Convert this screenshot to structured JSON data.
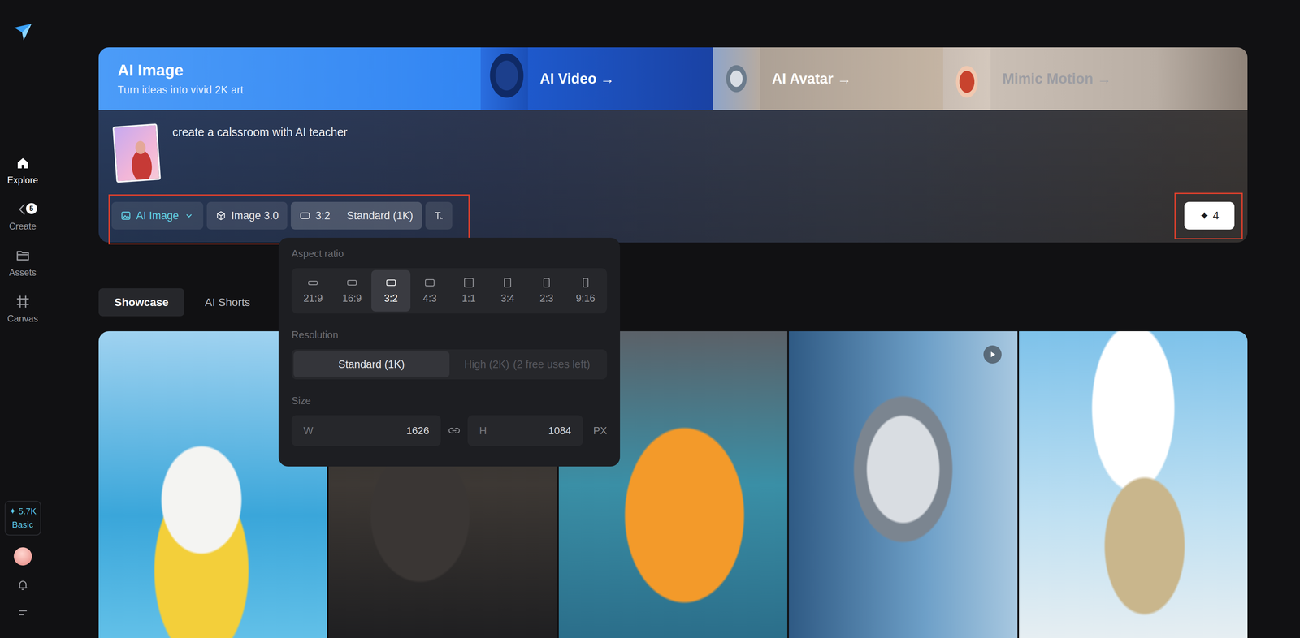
{
  "sidebar": {
    "items": [
      {
        "label": "Explore",
        "selected": true
      },
      {
        "label": "Create",
        "selected": false,
        "badge": "5"
      },
      {
        "label": "Assets",
        "selected": false
      },
      {
        "label": "Canvas",
        "selected": false
      }
    ],
    "credits": {
      "icon": "✦",
      "amount": "5.7K",
      "plan": "Basic"
    }
  },
  "banner": {
    "title": "AI Image",
    "subtitle": "Turn ideas into vivid 2K art",
    "links": [
      {
        "label": "AI Video →",
        "muted": false
      },
      {
        "label": "AI Avatar →",
        "muted": false
      },
      {
        "label": "Mimic Motion →",
        "muted": true
      }
    ]
  },
  "prompt": {
    "text": "create a calssroom with AI teacher"
  },
  "toolbar": {
    "annotated": true,
    "mode": {
      "label": "AI Image"
    },
    "model": {
      "label": "Image 3.0"
    },
    "ratio": {
      "value": "3:2",
      "resolution": "Standard (1K)",
      "expanded": true
    }
  },
  "generate": {
    "icon": "✦",
    "count": "4",
    "annotated": true
  },
  "popup": {
    "aspect_ratio": {
      "label": "Aspect ratio",
      "options": [
        {
          "label": "21:9",
          "selected": false
        },
        {
          "label": "16:9",
          "selected": false
        },
        {
          "label": "3:2",
          "selected": true
        },
        {
          "label": "4:3",
          "selected": false
        },
        {
          "label": "1:1",
          "selected": false
        },
        {
          "label": "3:4",
          "selected": false
        },
        {
          "label": "2:3",
          "selected": false
        },
        {
          "label": "9:16",
          "selected": false
        }
      ]
    },
    "resolution": {
      "label": "Resolution",
      "options": [
        {
          "label": "Standard (1K)",
          "note": "",
          "selected": true,
          "disabled": false
        },
        {
          "label": "High (2K)",
          "note": "(2 free uses left)",
          "selected": false,
          "disabled": true
        }
      ]
    },
    "size": {
      "label": "Size",
      "width_label": "W",
      "width": "1626",
      "height_label": "H",
      "height": "1084",
      "unit": "PX"
    }
  },
  "tabs": [
    {
      "label": "Showcase",
      "selected": true
    },
    {
      "label": "AI Shorts",
      "selected": false
    }
  ],
  "gallery": [
    {
      "video": false
    },
    {
      "video": false
    },
    {
      "video": false
    },
    {
      "video": true
    },
    {
      "video": false
    }
  ]
}
